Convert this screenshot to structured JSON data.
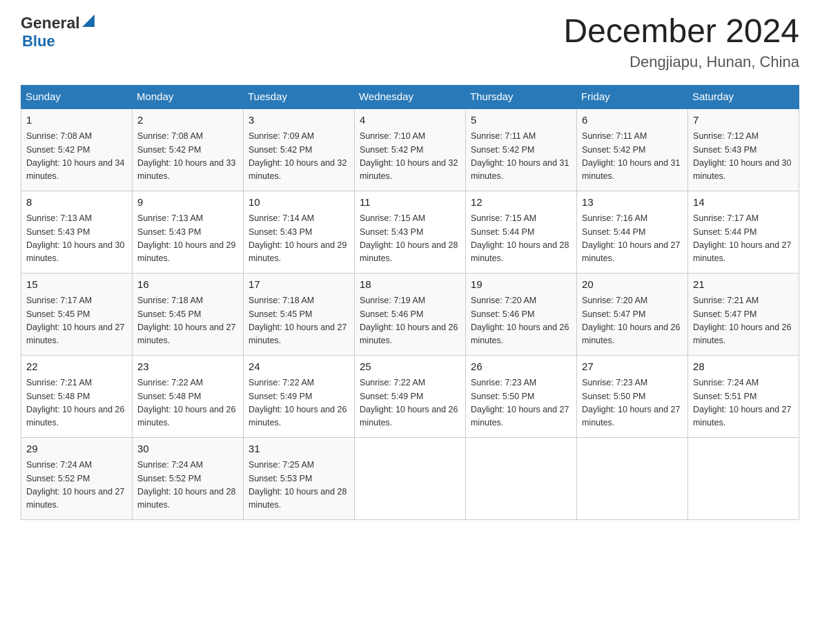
{
  "header": {
    "logo_general": "General",
    "logo_blue": "Blue",
    "month_title": "December 2024",
    "location": "Dengjiapu, Hunan, China"
  },
  "days_of_week": [
    "Sunday",
    "Monday",
    "Tuesday",
    "Wednesday",
    "Thursday",
    "Friday",
    "Saturday"
  ],
  "weeks": [
    [
      {
        "day": "1",
        "sunrise": "7:08 AM",
        "sunset": "5:42 PM",
        "daylight": "10 hours and 34 minutes."
      },
      {
        "day": "2",
        "sunrise": "7:08 AM",
        "sunset": "5:42 PM",
        "daylight": "10 hours and 33 minutes."
      },
      {
        "day": "3",
        "sunrise": "7:09 AM",
        "sunset": "5:42 PM",
        "daylight": "10 hours and 32 minutes."
      },
      {
        "day": "4",
        "sunrise": "7:10 AM",
        "sunset": "5:42 PM",
        "daylight": "10 hours and 32 minutes."
      },
      {
        "day": "5",
        "sunrise": "7:11 AM",
        "sunset": "5:42 PM",
        "daylight": "10 hours and 31 minutes."
      },
      {
        "day": "6",
        "sunrise": "7:11 AM",
        "sunset": "5:42 PM",
        "daylight": "10 hours and 31 minutes."
      },
      {
        "day": "7",
        "sunrise": "7:12 AM",
        "sunset": "5:43 PM",
        "daylight": "10 hours and 30 minutes."
      }
    ],
    [
      {
        "day": "8",
        "sunrise": "7:13 AM",
        "sunset": "5:43 PM",
        "daylight": "10 hours and 30 minutes."
      },
      {
        "day": "9",
        "sunrise": "7:13 AM",
        "sunset": "5:43 PM",
        "daylight": "10 hours and 29 minutes."
      },
      {
        "day": "10",
        "sunrise": "7:14 AM",
        "sunset": "5:43 PM",
        "daylight": "10 hours and 29 minutes."
      },
      {
        "day": "11",
        "sunrise": "7:15 AM",
        "sunset": "5:43 PM",
        "daylight": "10 hours and 28 minutes."
      },
      {
        "day": "12",
        "sunrise": "7:15 AM",
        "sunset": "5:44 PM",
        "daylight": "10 hours and 28 minutes."
      },
      {
        "day": "13",
        "sunrise": "7:16 AM",
        "sunset": "5:44 PM",
        "daylight": "10 hours and 27 minutes."
      },
      {
        "day": "14",
        "sunrise": "7:17 AM",
        "sunset": "5:44 PM",
        "daylight": "10 hours and 27 minutes."
      }
    ],
    [
      {
        "day": "15",
        "sunrise": "7:17 AM",
        "sunset": "5:45 PM",
        "daylight": "10 hours and 27 minutes."
      },
      {
        "day": "16",
        "sunrise": "7:18 AM",
        "sunset": "5:45 PM",
        "daylight": "10 hours and 27 minutes."
      },
      {
        "day": "17",
        "sunrise": "7:18 AM",
        "sunset": "5:45 PM",
        "daylight": "10 hours and 27 minutes."
      },
      {
        "day": "18",
        "sunrise": "7:19 AM",
        "sunset": "5:46 PM",
        "daylight": "10 hours and 26 minutes."
      },
      {
        "day": "19",
        "sunrise": "7:20 AM",
        "sunset": "5:46 PM",
        "daylight": "10 hours and 26 minutes."
      },
      {
        "day": "20",
        "sunrise": "7:20 AM",
        "sunset": "5:47 PM",
        "daylight": "10 hours and 26 minutes."
      },
      {
        "day": "21",
        "sunrise": "7:21 AM",
        "sunset": "5:47 PM",
        "daylight": "10 hours and 26 minutes."
      }
    ],
    [
      {
        "day": "22",
        "sunrise": "7:21 AM",
        "sunset": "5:48 PM",
        "daylight": "10 hours and 26 minutes."
      },
      {
        "day": "23",
        "sunrise": "7:22 AM",
        "sunset": "5:48 PM",
        "daylight": "10 hours and 26 minutes."
      },
      {
        "day": "24",
        "sunrise": "7:22 AM",
        "sunset": "5:49 PM",
        "daylight": "10 hours and 26 minutes."
      },
      {
        "day": "25",
        "sunrise": "7:22 AM",
        "sunset": "5:49 PM",
        "daylight": "10 hours and 26 minutes."
      },
      {
        "day": "26",
        "sunrise": "7:23 AM",
        "sunset": "5:50 PM",
        "daylight": "10 hours and 27 minutes."
      },
      {
        "day": "27",
        "sunrise": "7:23 AM",
        "sunset": "5:50 PM",
        "daylight": "10 hours and 27 minutes."
      },
      {
        "day": "28",
        "sunrise": "7:24 AM",
        "sunset": "5:51 PM",
        "daylight": "10 hours and 27 minutes."
      }
    ],
    [
      {
        "day": "29",
        "sunrise": "7:24 AM",
        "sunset": "5:52 PM",
        "daylight": "10 hours and 27 minutes."
      },
      {
        "day": "30",
        "sunrise": "7:24 AM",
        "sunset": "5:52 PM",
        "daylight": "10 hours and 28 minutes."
      },
      {
        "day": "31",
        "sunrise": "7:25 AM",
        "sunset": "5:53 PM",
        "daylight": "10 hours and 28 minutes."
      },
      null,
      null,
      null,
      null
    ]
  ]
}
